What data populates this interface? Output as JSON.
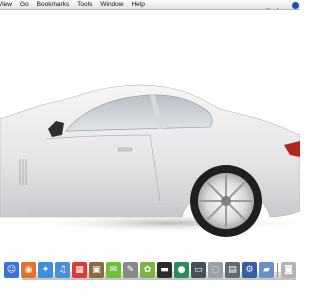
{
  "menubar": {
    "items": [
      "View",
      "Go",
      "Bookmarks",
      "Tools",
      "Window",
      "Help"
    ]
  },
  "desktop": {
    "wallpaper": "white-sports-coupe-car",
    "car_color": "#e9e9ea",
    "background_color": "#ffffff"
  },
  "dock": {
    "icons": [
      {
        "name": "finder-icon",
        "color": "#3b73d6",
        "glyph": "☺"
      },
      {
        "name": "firefox-icon",
        "color": "#e8702a",
        "glyph": "◉"
      },
      {
        "name": "safari-icon",
        "color": "#3d8fd9",
        "glyph": "✦"
      },
      {
        "name": "itunes-icon",
        "color": "#4a90d9",
        "glyph": "♫"
      },
      {
        "name": "ical-icon",
        "color": "#d93b3b",
        "glyph": "▦"
      },
      {
        "name": "photo-icon",
        "color": "#8d6a3f",
        "glyph": "▣"
      },
      {
        "name": "chat-icon",
        "color": "#6cbf3a",
        "glyph": "✉"
      },
      {
        "name": "script-icon",
        "color": "#888888",
        "glyph": "✎"
      },
      {
        "name": "android-icon",
        "color": "#7cb342",
        "glyph": "✿"
      },
      {
        "name": "terminal-icon",
        "color": "#2b2b2b",
        "glyph": "▬"
      },
      {
        "name": "globe-icon",
        "color": "#2e8b57",
        "glyph": "●"
      },
      {
        "name": "monitor-icon",
        "color": "#44505c",
        "glyph": "▭"
      },
      {
        "name": "disk-icon",
        "color": "#9aa0a6",
        "glyph": "◌"
      },
      {
        "name": "calculator-icon",
        "color": "#5f6a74",
        "glyph": "▤"
      },
      {
        "name": "network-icon",
        "color": "#3a5fa0",
        "glyph": "⚙"
      },
      {
        "name": "folder-icon",
        "color": "#6b8fc7",
        "glyph": "▰"
      },
      {
        "name": "trash-icon",
        "color": "#b0b4b8",
        "glyph": "◙"
      }
    ]
  },
  "status": {
    "icons": [
      {
        "name": "script-menu-icon",
        "color": "#555555"
      },
      {
        "name": "bluetooth-icon",
        "color": "#4a7bd0"
      },
      {
        "name": "wifi-icon",
        "color": "#333333"
      },
      {
        "name": "spotlight-icon",
        "color": "#1a4fb0"
      }
    ]
  }
}
